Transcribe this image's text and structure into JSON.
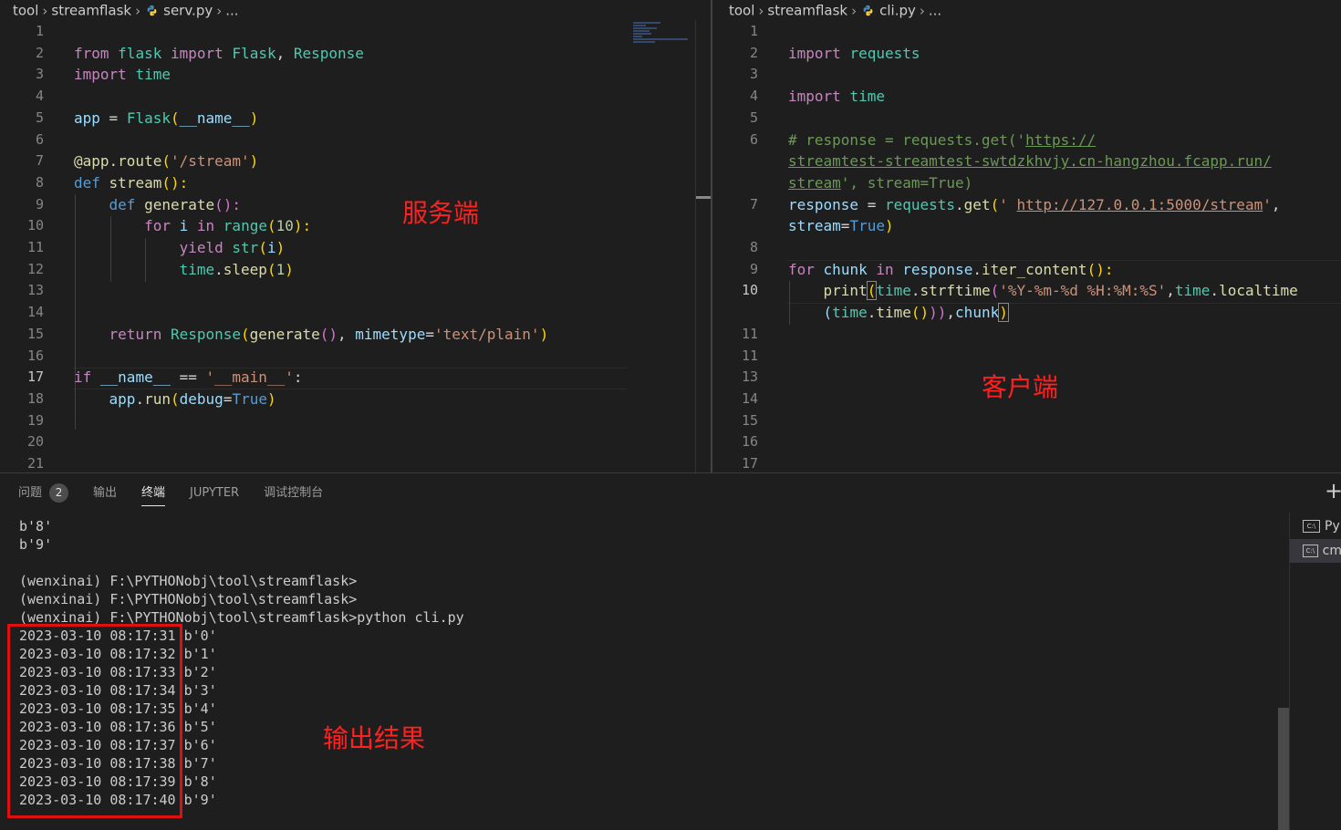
{
  "left_editor": {
    "breadcrumb": {
      "parts": [
        "tool",
        "streamflask"
      ],
      "file": "serv.py",
      "ellipsis": "..."
    },
    "line_numbers": [
      "1",
      "2",
      "3",
      "4",
      "5",
      "6",
      "7",
      "8",
      "9",
      "10",
      "11",
      "12",
      "13",
      "14",
      "15",
      "16",
      "17",
      "18",
      "19",
      "20",
      "21"
    ],
    "active_line": "17",
    "code": {
      "l2": {
        "from": "from",
        "module": "flask",
        "import": "import",
        "cls1": "Flask",
        "comma": ",",
        "cls2": "Response"
      },
      "l3": {
        "import": "import",
        "module": "time"
      },
      "l5": {
        "var": "app",
        "eq": " = ",
        "cls": "Flask",
        "open": "(",
        "arg": "__name__",
        "close": ")"
      },
      "l7": {
        "deco": "@app.route",
        "open": "(",
        "str": "'/stream'",
        "close": ")"
      },
      "l8": {
        "def": "def",
        "fn": "stream",
        "paren": "():"
      },
      "l9": {
        "def": "def",
        "fn": "generate",
        "paren": "():"
      },
      "l10": {
        "for": "for",
        "var": "i",
        "in": "in",
        "fn": "range",
        "open": "(",
        "num": "10",
        "close": "):"
      },
      "l11": {
        "yield": "yield",
        "fn": "str",
        "open": "(",
        "var": "i",
        "close": ")"
      },
      "l12": {
        "mod": "time",
        "dot": ".",
        "fn": "sleep",
        "open": "(",
        "num": "1",
        "close": ")"
      },
      "l15": {
        "ret": "return",
        "cls": "Response",
        "open": "(",
        "fn": "generate",
        "fp": "()",
        "comma": ", ",
        "kw": "mimetype",
        "eq": "=",
        "str": "'text/plain'",
        "close": ")"
      },
      "l17": {
        "if": "if",
        "name": "__name__",
        "op": " == ",
        "str": "'__main__'",
        "colon": ":"
      },
      "l18": {
        "var": "app",
        "dot": ".",
        "fn": "run",
        "open": "(",
        "kw": "debug",
        "eq": "=",
        "val": "True",
        "close": ")"
      }
    },
    "annotation": "服务端"
  },
  "right_editor": {
    "breadcrumb": {
      "parts": [
        "tool",
        "streamflask"
      ],
      "file": "cli.py",
      "ellipsis": "..."
    },
    "line_numbers": [
      "1",
      "2",
      "3",
      "4",
      "5",
      "6",
      "",
      "",
      "7",
      "",
      "8",
      "9",
      "10",
      "",
      "11",
      "12",
      "13",
      "14",
      "15",
      "16",
      "17"
    ],
    "active_line": "10",
    "code": {
      "l2": {
        "import": "import",
        "module": "requests"
      },
      "l4": {
        "import": "import",
        "module": "time"
      },
      "l6a": {
        "c1": "# response = requests.get('",
        "url": "https://"
      },
      "l6b": {
        "url": "streamtest-streamtest-swtdzkhvjy.cn-hangzhou.fcapp.run/"
      },
      "l6c": {
        "url": "stream",
        "rest": "', stream=True)"
      },
      "l7a": {
        "var": "response",
        "eq": " = ",
        "mod": "requests",
        "dot": ".",
        "fn": "get",
        "open": "(",
        "q": "' ",
        "url": "http://127.0.0.1:5000/stream",
        "q2": "'",
        "comma": ","
      },
      "l7b": {
        "kw": "stream",
        "eq": "=",
        "val": "True",
        "close": ")"
      },
      "l9": {
        "for": "for",
        "var": "chunk",
        "in": "in",
        "obj": "response",
        "dot": ".",
        "fn": "iter_content",
        "paren": "():"
      },
      "l10a": {
        "fn": "print",
        "open": "(",
        "mod": "time",
        "dot": ".",
        "fn2": "strftime",
        "open2": "(",
        "str": "'%Y-%m-%d %H:%M:%S'",
        "comma": ",",
        "mod2": "time",
        "dot2": ".",
        "fn3": "localtime"
      },
      "l10b": {
        "open": "(",
        "mod": "time",
        "dot": ".",
        "fn": "time",
        "parens": "()",
        "close": "))",
        "comma": ",",
        "var": "chunk",
        "close2": ")"
      }
    },
    "annotation": "客户端"
  },
  "panel": {
    "tabs": [
      {
        "label": "问题",
        "badge": "2"
      },
      {
        "label": "输出"
      },
      {
        "label": "终端",
        "active": true
      },
      {
        "label": "JUPYTER"
      },
      {
        "label": "调试控制台"
      }
    ],
    "terminal_lines": [
      "b'8'",
      "b'9'",
      "",
      "(wenxinai) F:\\PYTHONobj\\tool\\streamflask>",
      "(wenxinai) F:\\PYTHONobj\\tool\\streamflask>",
      "(wenxinai) F:\\PYTHONobj\\tool\\streamflask>python cli.py",
      "2023-03-10 08:17:31 b'0'",
      "2023-03-10 08:17:32 b'1'",
      "2023-03-10 08:17:33 b'2'",
      "2023-03-10 08:17:34 b'3'",
      "2023-03-10 08:17:35 b'4'",
      "2023-03-10 08:17:36 b'5'",
      "2023-03-10 08:17:37 b'6'",
      "2023-03-10 08:17:38 b'7'",
      "2023-03-10 08:17:39 b'8'",
      "2023-03-10 08:17:40 b'9'"
    ],
    "annotation": "输出结果",
    "terminal_list": [
      {
        "icon": "terminal-icon",
        "label": "Py"
      },
      {
        "icon": "terminal-icon",
        "label": "cm"
      }
    ],
    "icons": {
      "new_terminal": "plus-icon",
      "python_file": "python-file-icon"
    },
    "new_terminal_glyph": "+"
  },
  "colors": {
    "annotation": "#ff2020",
    "highlight_box": "#e01010",
    "background": "#1e1e1e"
  }
}
